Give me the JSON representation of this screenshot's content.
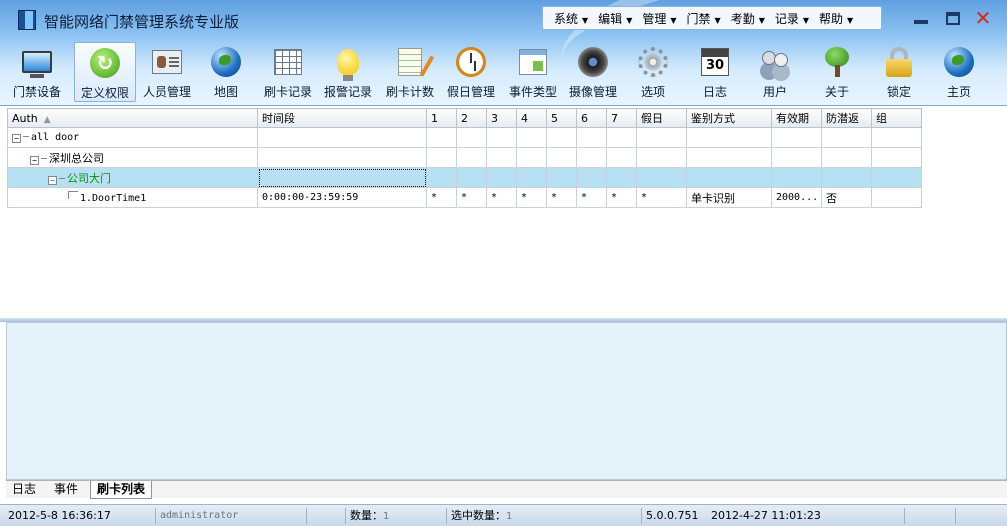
{
  "window": {
    "title": "智能网络门禁管理系统专业版"
  },
  "menu": [
    {
      "label": "系统"
    },
    {
      "label": "编辑"
    },
    {
      "label": "管理"
    },
    {
      "label": "门禁"
    },
    {
      "label": "考勤"
    },
    {
      "label": "记录"
    },
    {
      "label": "帮助"
    }
  ],
  "toolbar": [
    {
      "label": "门禁设备",
      "icon": "monitor-icon"
    },
    {
      "label": "定义权限",
      "icon": "refresh-icon",
      "active": true
    },
    {
      "label": "人员管理",
      "icon": "id-card-icon"
    },
    {
      "label": "地图",
      "icon": "globe-icon"
    },
    {
      "label": "刷卡记录",
      "icon": "grid-icon"
    },
    {
      "label": "报警记录",
      "icon": "lightbulb-icon"
    },
    {
      "label": "刷卡计数",
      "icon": "notepad-icon"
    },
    {
      "label": "假日管理",
      "icon": "alarm-clock-icon"
    },
    {
      "label": "事件类型",
      "icon": "window-chart-icon"
    },
    {
      "label": "摄像管理",
      "icon": "camera-lens-icon"
    },
    {
      "label": "选项",
      "icon": "gear-icon"
    },
    {
      "label": "日志",
      "icon": "calendar-icon"
    },
    {
      "label": "用户",
      "icon": "users-icon"
    },
    {
      "label": "关于",
      "icon": "tree-icon"
    },
    {
      "label": "锁定",
      "icon": "padlock-icon"
    },
    {
      "label": "主页",
      "icon": "globe-icon"
    }
  ],
  "grid": {
    "columns": [
      "Auth",
      "时间段",
      "1",
      "2",
      "3",
      "4",
      "5",
      "6",
      "7",
      "假日",
      "鉴别方式",
      "有效期",
      "防潜返",
      "组"
    ],
    "rows": [
      {
        "level": 0,
        "toggle": "−",
        "name": "all door",
        "cells": [
          "",
          "",
          "",
          "",
          "",
          "",
          "",
          "",
          "",
          "",
          "",
          "",
          ""
        ]
      },
      {
        "level": 1,
        "toggle": "−",
        "name": "深圳总公司",
        "cells": [
          "",
          "",
          "",
          "",
          "",
          "",
          "",
          "",
          "",
          "",
          "",
          "",
          ""
        ]
      },
      {
        "level": 2,
        "toggle": "−",
        "name": "公司大门",
        "selected": true,
        "cells": [
          "",
          "",
          "",
          "",
          "",
          "",
          "",
          "",
          "",
          "",
          "",
          "",
          ""
        ]
      },
      {
        "level": 3,
        "toggle": "",
        "name": "1.DoorTime1",
        "cells": [
          "0:00:00-23:59:59",
          "*",
          "*",
          "*",
          "*",
          "*",
          "*",
          "*",
          "*",
          "单卡识别",
          "2000...",
          "否",
          ""
        ]
      }
    ]
  },
  "tabs": [
    {
      "label": "日志"
    },
    {
      "label": "事件"
    },
    {
      "label": "刷卡列表",
      "active": true
    }
  ],
  "status": {
    "datetime": "2012-5-8 16:36:17",
    "user": "administrator",
    "count_label": "数量：",
    "count_value": "1",
    "selected_label": "选中数量：",
    "selected_value": "1",
    "version": "5.0.0.751",
    "build_date": "2012-4-27 11:01:23"
  },
  "colors": {
    "selected_row": "#b7e1f3",
    "lower_pane": "#e3f3f9",
    "close_button": "#d42a16"
  }
}
